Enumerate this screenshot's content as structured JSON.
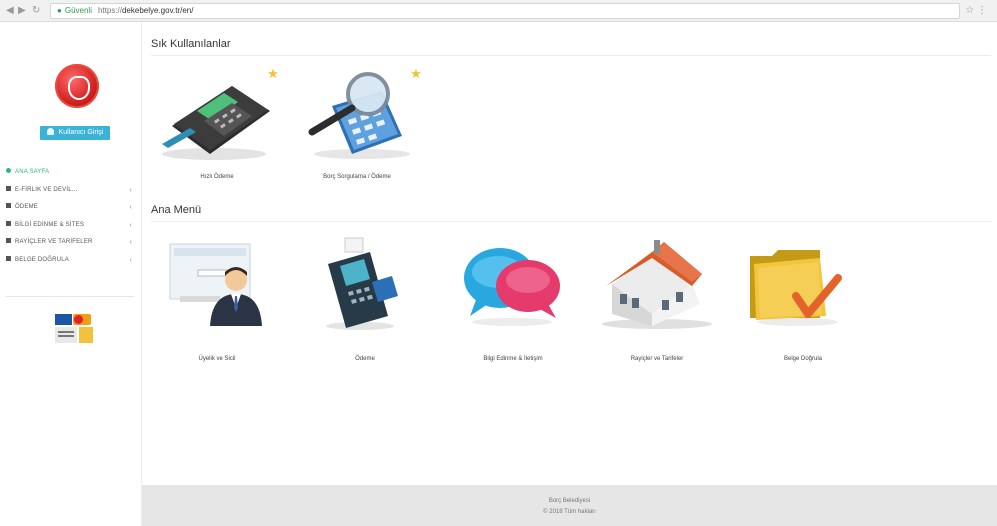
{
  "browser": {
    "secure_label": "Güvenli",
    "url_scheme": "https://",
    "url_host": "dekebelye.gov.tr/en/"
  },
  "sidebar": {
    "login_label": "Kullanıcı Girişi",
    "menu": [
      {
        "label": "ANA SAYFA",
        "active": true
      },
      {
        "label": "E-FİRLIK VE DEVİL...",
        "active": false
      },
      {
        "label": "ÖDEME",
        "active": false
      },
      {
        "label": "BİLGİ EDİNME & SİTES",
        "active": false
      },
      {
        "label": "RAYİÇLER VE TARİFELER",
        "active": false
      },
      {
        "label": "BELGE DOĞRULA",
        "active": false
      }
    ]
  },
  "main": {
    "favorites_title": "Sık Kullanılanlar",
    "favorites": [
      {
        "label": "Hızlı Ödeme",
        "icon": "pos-terminal-icon",
        "starred": true
      },
      {
        "label": "Borç Sorgulama / Ödeme",
        "icon": "calculator-magnifier-icon",
        "starred": true
      }
    ],
    "menu_title": "Ana Menü",
    "items": [
      {
        "label": "Üyelik ve Sicil",
        "icon": "registration-person-icon"
      },
      {
        "label": "Ödeme",
        "icon": "card-terminal-icon"
      },
      {
        "label": "Bilgi Edinme & İletişim",
        "icon": "speech-bubbles-icon"
      },
      {
        "label": "Rayiçler ve Tarifeler",
        "icon": "house-icon"
      },
      {
        "label": "Belge Doğrula",
        "icon": "folder-check-icon"
      }
    ]
  },
  "footer": {
    "line1": "Borç Belediyesi",
    "line2": "© 2018 Tüm hakları"
  }
}
